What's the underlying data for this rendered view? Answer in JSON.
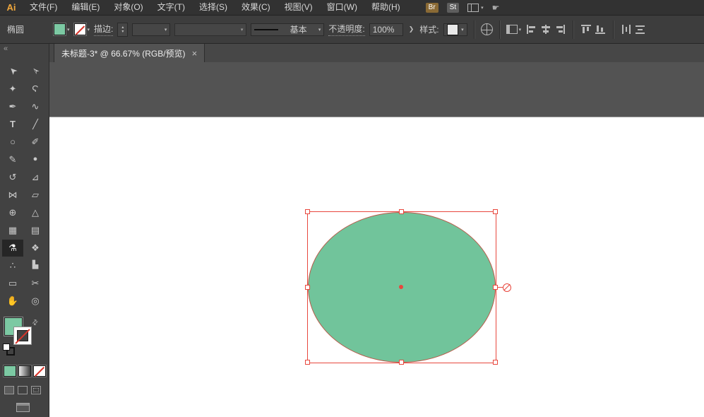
{
  "colors": {
    "ellipse_fill": "#71c49b",
    "selection": "#e8473d",
    "swatch_green": "#7cc9a3",
    "none_slash": "#d9352b",
    "pasteboard": "#535353",
    "artboard": "#ffffff"
  },
  "menubar": {
    "logo": "Ai",
    "items": [
      "文件(F)",
      "编辑(E)",
      "对象(O)",
      "文字(T)",
      "选择(S)",
      "效果(C)",
      "视图(V)",
      "窗口(W)",
      "帮助(H)"
    ],
    "bridge_badge": "Br",
    "stock_badge": "St"
  },
  "control_bar": {
    "context_label": "椭圆",
    "stroke_label": "描边:",
    "brush_name": "基本",
    "opacity_label": "不透明度:",
    "opacity_value": "100%",
    "style_label": "样式:"
  },
  "document_tab": {
    "title": "未标题-3* @ 66.67% (RGB/预览)",
    "close_glyph": "×"
  },
  "glyphs": {
    "caret": "▾",
    "spin_up": "▴",
    "spin_down": "▾",
    "expander": "❯",
    "swap": "⇄",
    "collapse": "«",
    "hand": "☛"
  },
  "tool_panel": {
    "tools": [
      {
        "name": "selection-tool",
        "glyph": "➤"
      },
      {
        "name": "direct-selection-tool",
        "glyph": "➢"
      },
      {
        "name": "magic-wand-tool",
        "glyph": "✦"
      },
      {
        "name": "lasso-tool",
        "glyph": "Ϛ"
      },
      {
        "name": "pen-tool",
        "glyph": "✒"
      },
      {
        "name": "curvature-tool",
        "glyph": "∿"
      },
      {
        "name": "type-tool",
        "glyph": "T"
      },
      {
        "name": "line-tool",
        "glyph": "╱"
      },
      {
        "name": "ellipse-tool",
        "glyph": "○"
      },
      {
        "name": "paintbrush-tool",
        "glyph": "✐"
      },
      {
        "name": "pencil-tool",
        "glyph": "✎"
      },
      {
        "name": "blob-brush-tool",
        "glyph": "●"
      },
      {
        "name": "rotate-tool",
        "glyph": "↺"
      },
      {
        "name": "scale-tool",
        "glyph": "⊿"
      },
      {
        "name": "width-tool",
        "glyph": "⋈"
      },
      {
        "name": "free-transform-tool",
        "glyph": "▱"
      },
      {
        "name": "shape-builder-tool",
        "glyph": "⊕"
      },
      {
        "name": "perspective-grid-tool",
        "glyph": "△"
      },
      {
        "name": "mesh-tool",
        "glyph": "▦"
      },
      {
        "name": "gradient-tool",
        "glyph": "▤"
      },
      {
        "name": "eyedropper-tool",
        "glyph": "⚗"
      },
      {
        "name": "blend-tool",
        "glyph": "❖"
      },
      {
        "name": "symbol-sprayer-tool",
        "glyph": "∴"
      },
      {
        "name": "column-graph-tool",
        "glyph": "▙"
      },
      {
        "name": "artboard-tool",
        "glyph": "▭"
      },
      {
        "name": "slice-tool",
        "glyph": "✂"
      },
      {
        "name": "hand-tool",
        "glyph": "✋"
      },
      {
        "name": "zoom-tool",
        "glyph": "◎"
      }
    ]
  }
}
